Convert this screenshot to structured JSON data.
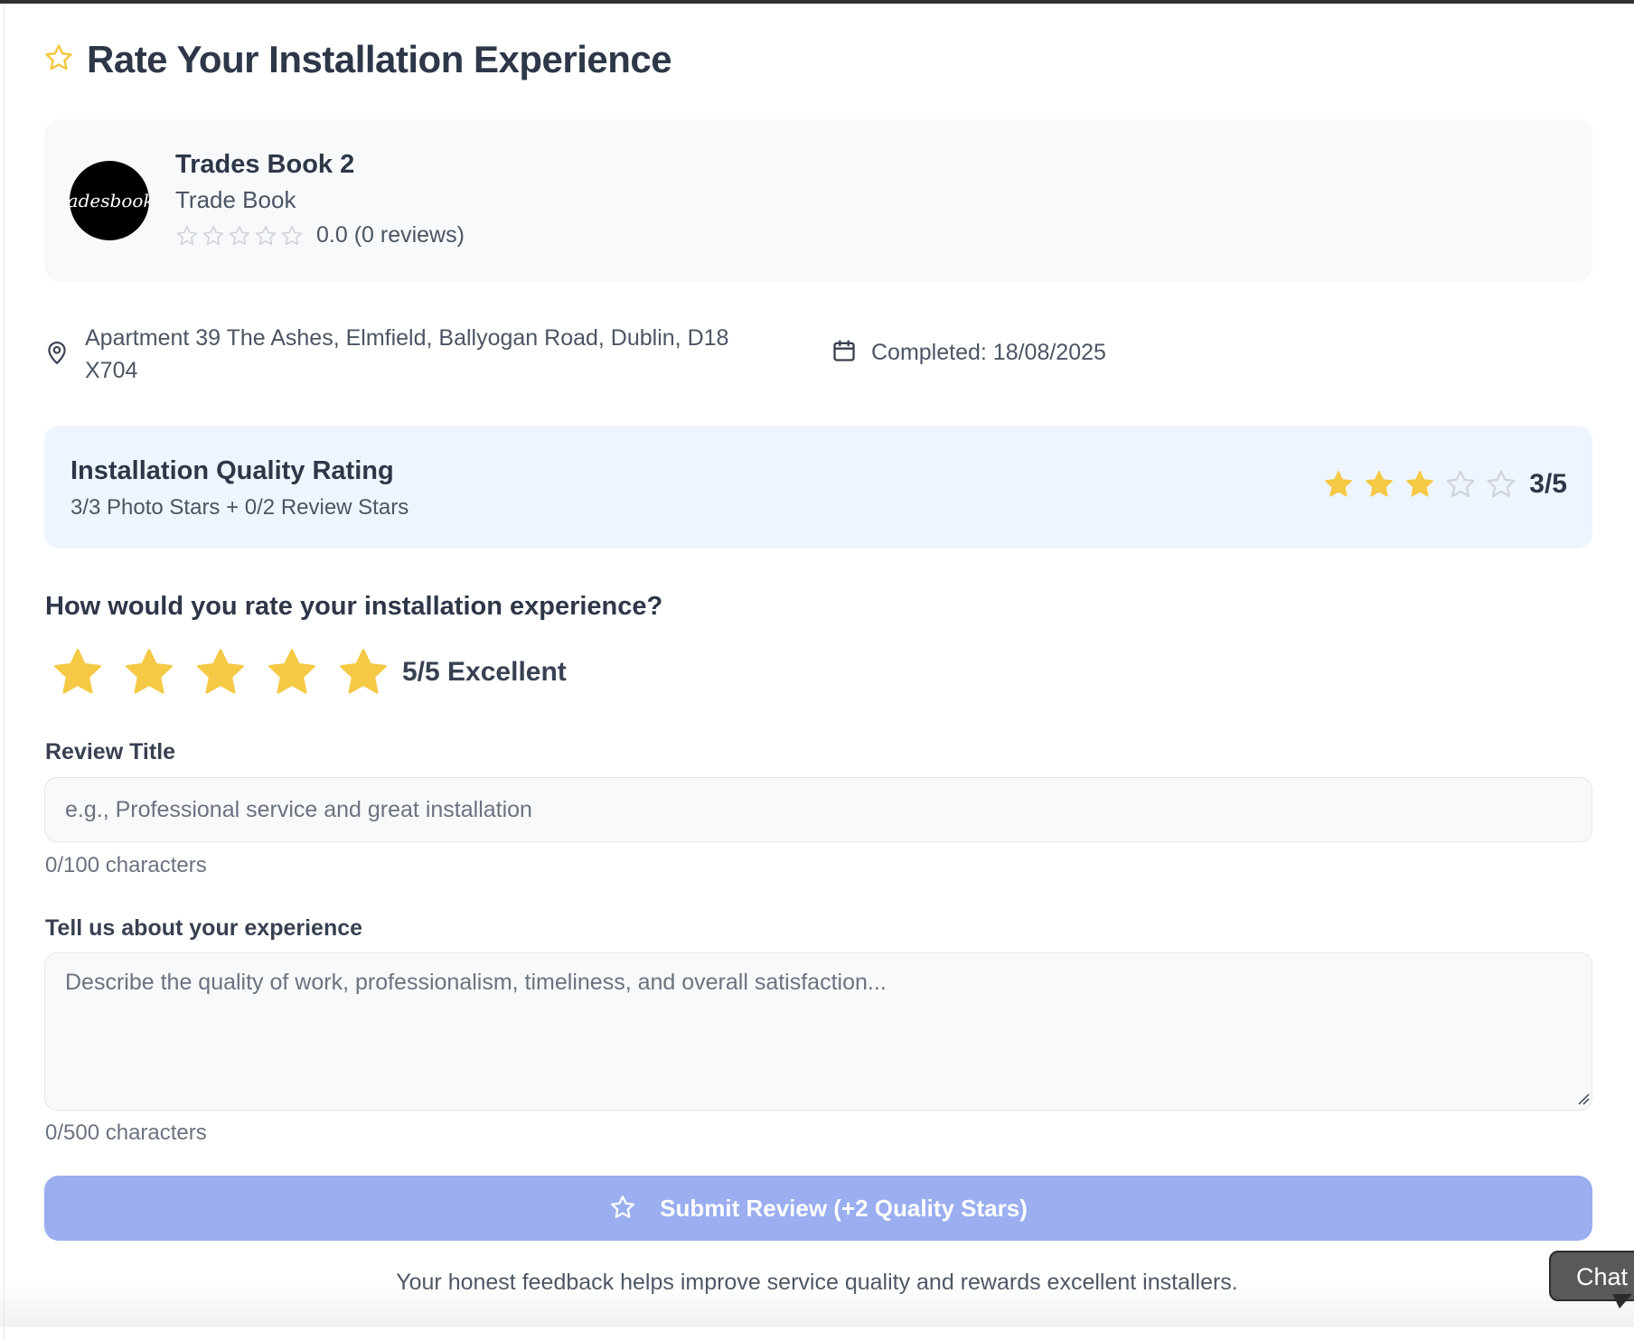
{
  "page": {
    "title": "Rate Your Installation Experience",
    "title_icon": "star-outline-icon"
  },
  "installer": {
    "avatar_text": "radesbook.",
    "name": "Trades Book 2",
    "subtitle": "Trade Book",
    "rating": 0,
    "rating_text": "0.0 (0 reviews)"
  },
  "job": {
    "address": "Apartment 39 The Ashes, Elmfield, Ballyogan Road, Dublin, D18 X704",
    "completed": "Completed: 18/08/2025"
  },
  "quality": {
    "title": "Installation Quality Rating",
    "subtitle": "3/3 Photo Stars + 0/2 Review Stars",
    "stars_filled": 3,
    "stars_total": 5,
    "score": "3/5"
  },
  "rating_input": {
    "question": "How would you rate your installation experience?",
    "value": 5,
    "max": 5,
    "label": "5/5 Excellent"
  },
  "form": {
    "title_label": "Review Title",
    "title_value": "",
    "title_placeholder": "e.g., Professional service and great installation",
    "title_counter": "0/100 characters",
    "body_label": "Tell us about your experience",
    "body_value": "",
    "body_placeholder": "Describe the quality of work, professionalism, timeliness, and overall satisfaction...",
    "body_counter": "0/500 characters",
    "submit_label": "Submit Review (+2 Quality Stars)"
  },
  "footer": {
    "note": "Your honest feedback helps improve service quality and rewards excellent installers."
  },
  "chat": {
    "label": "Chat"
  },
  "colors": {
    "star_filled": "#f5c945",
    "star_empty_stroke": "#d1d5db",
    "submit_bg": "#9aaef0",
    "quality_bg": "#eef5fe",
    "card_bg": "#f7f9fb"
  }
}
